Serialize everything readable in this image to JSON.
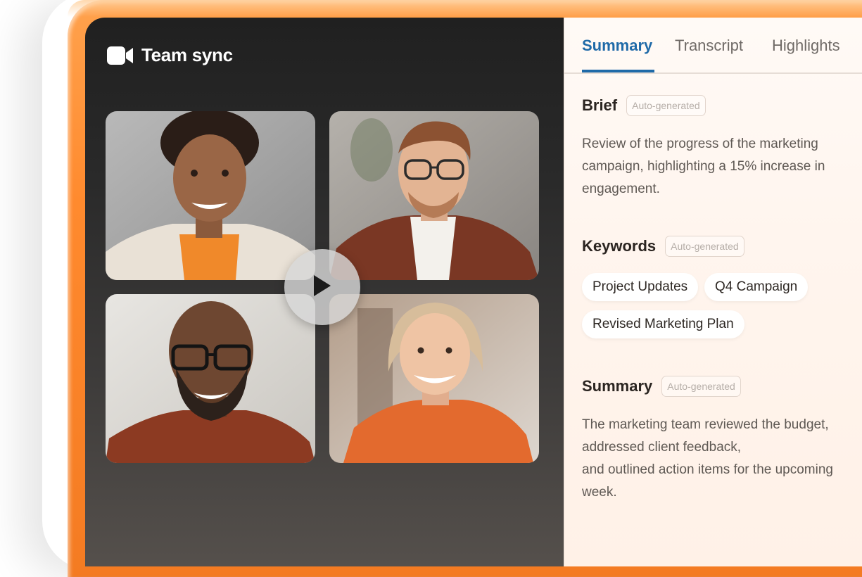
{
  "meeting": {
    "title": "Team sync",
    "app_icon": "video-camera-icon",
    "play_icon": "play-icon"
  },
  "tabs": [
    {
      "label": "Summary",
      "active": true
    },
    {
      "label": "Transcript",
      "active": false
    },
    {
      "label": "Highlights",
      "active": false
    }
  ],
  "brief": {
    "title": "Brief",
    "badge": "Auto-generated",
    "text": "Review of the progress of the marketing campaign, highlighting a 15% increase in engagement."
  },
  "keywords": {
    "title": "Keywords",
    "badge": "Auto-generated",
    "items": [
      "Project Updates",
      "Q4 Campaign",
      "Revised Marketing Plan"
    ]
  },
  "summary": {
    "title": "Summary",
    "badge": "Auto-generated",
    "lines": [
      "The marketing team reviewed the budget,",
      "addressed client feedback,",
      "and outlined action items for the upcoming week."
    ]
  },
  "colors": {
    "accent": "#1f6aa8",
    "frame": "#ff8a2e"
  }
}
